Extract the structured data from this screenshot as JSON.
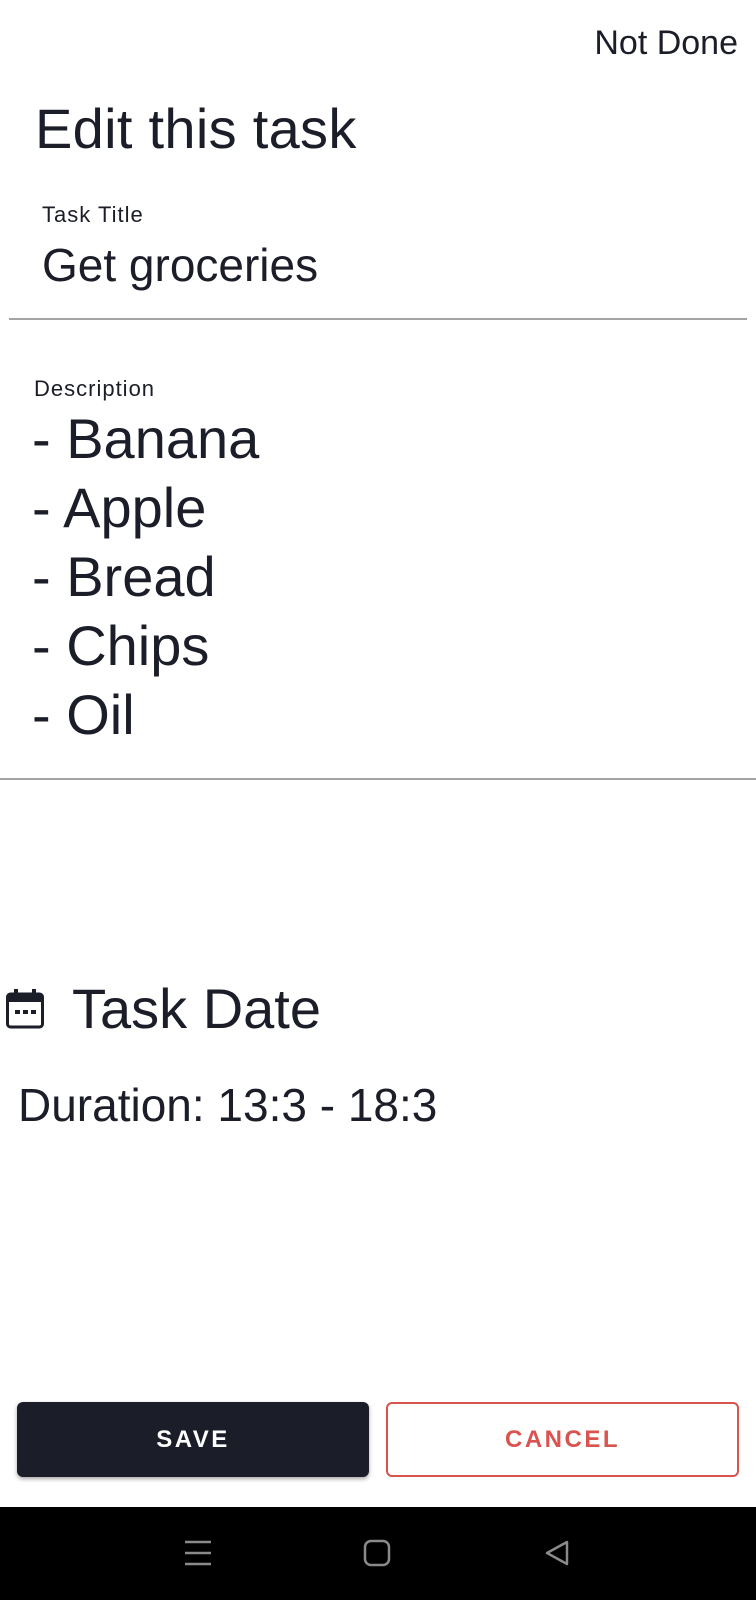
{
  "header": {
    "status_label": "Not Done",
    "page_title": "Edit this task"
  },
  "title_field": {
    "label": "Task Title",
    "value": "Get groceries"
  },
  "description_field": {
    "label": "Description",
    "lines": [
      "- Banana",
      "- Apple",
      "- Bread",
      "- Chips",
      "- Oil"
    ]
  },
  "task_date": {
    "icon": "calendar-icon",
    "heading": "Task Date",
    "duration": "Duration: 13:3 - 18:3"
  },
  "actions": {
    "save_label": "SAVE",
    "cancel_label": "CANCEL"
  },
  "system_nav": {
    "icons": [
      "menu-icon",
      "home-icon",
      "back-icon"
    ]
  },
  "colors": {
    "primary": "#1b1d28",
    "cancel": "#d9534f",
    "divider": "#a3a3a6",
    "nav_bar": "#000000"
  }
}
